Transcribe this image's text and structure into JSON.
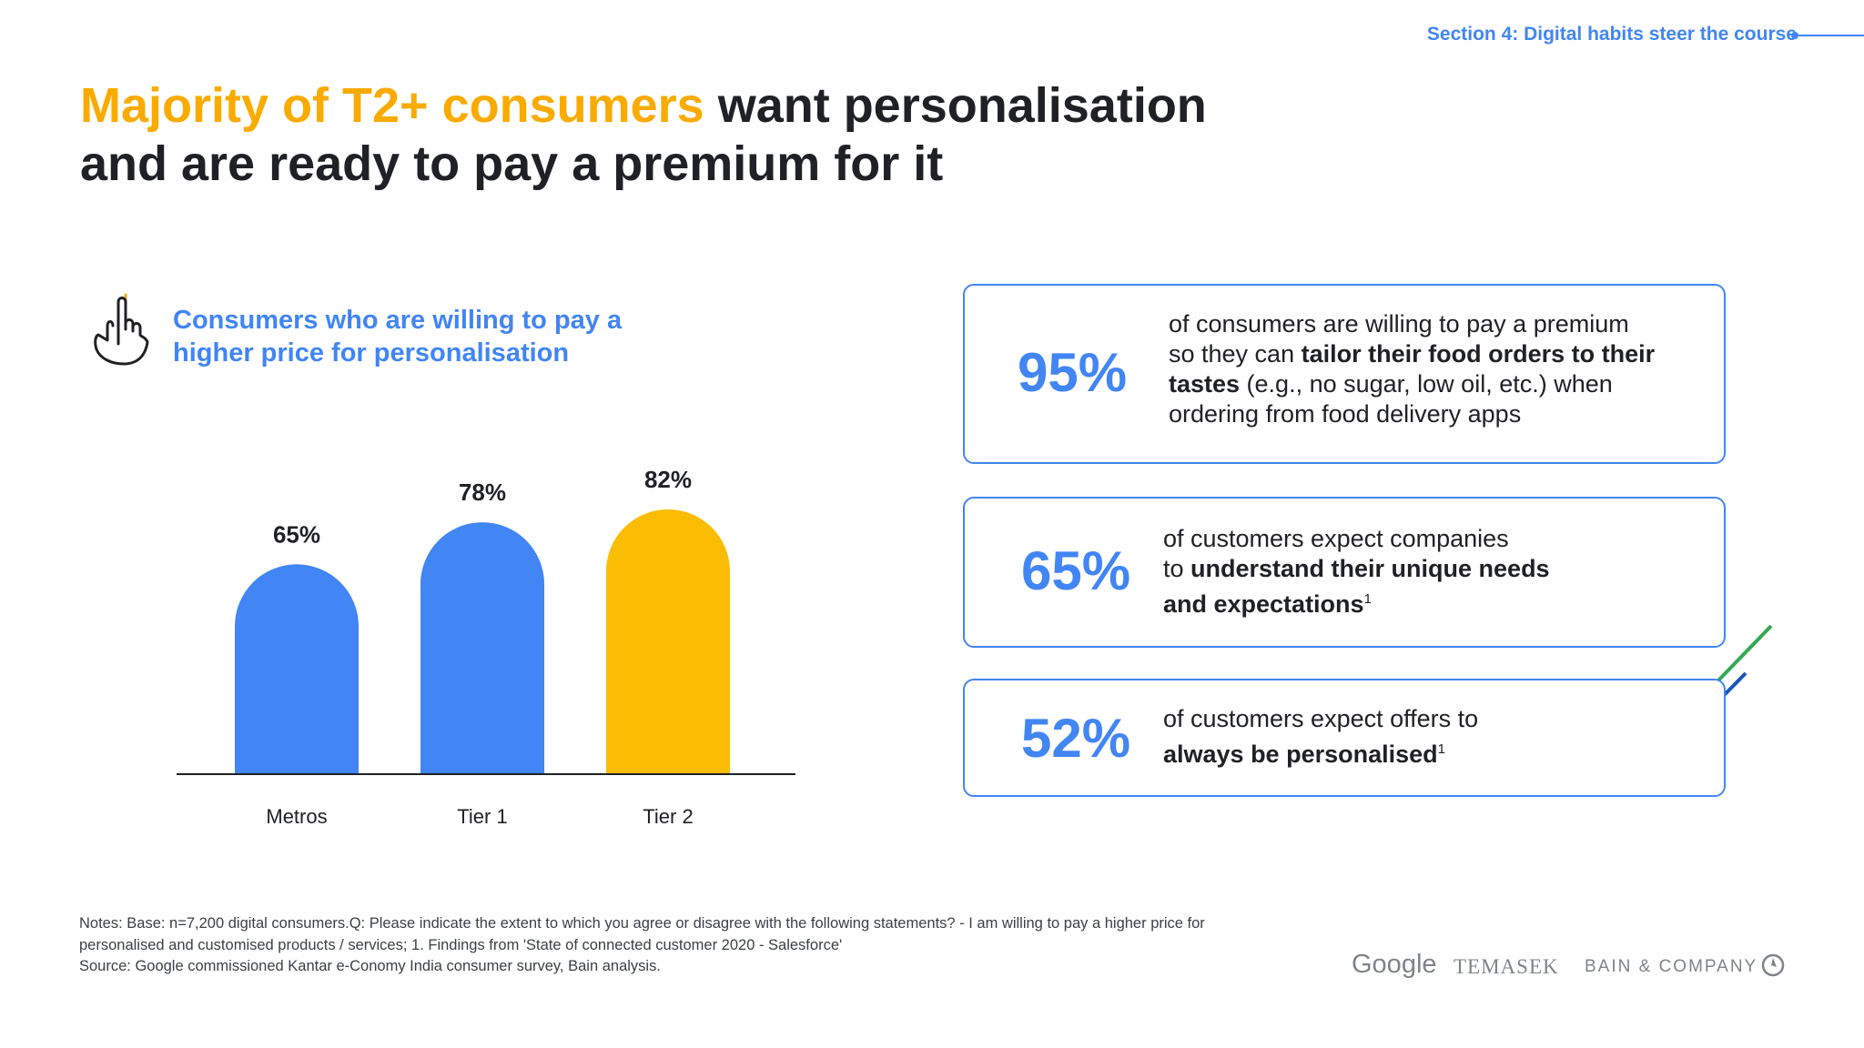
{
  "header": {
    "section": "Section 4: Digital habits steer the course"
  },
  "title": {
    "highlight": "Majority of T2+ consumers",
    "rest_line1": " want personalisation",
    "line2": "and are ready to pay a premium for it"
  },
  "chart_heading": {
    "icon": "hand-pointer-icon",
    "line1": "Consumers who are willing to pay a",
    "line2": "higher price for personalisation"
  },
  "chart_data": {
    "type": "bar",
    "categories": [
      "Metros",
      "Tier 1",
      "Tier 2"
    ],
    "values": [
      65,
      78,
      82
    ],
    "data_labels": [
      "65%",
      "78%",
      "82%"
    ],
    "colors": [
      "#4285F4",
      "#4285F4",
      "#FBBC04"
    ],
    "ylim": [
      0,
      100
    ],
    "grid": false
  },
  "stats": [
    {
      "value": "95%",
      "t1": "of consumers are willing to pay a premium",
      "t2": "so they can ",
      "b1": "tailor their food orders to their",
      "b2": "tastes",
      "t3": " (e.g., no sugar, low oil, etc.) when",
      "t4": "ordering from food delivery apps"
    },
    {
      "value": "65%",
      "t1": "of customers expect companies",
      "t2": "to ",
      "b1": "understand their unique needs",
      "b2": "and expectations",
      "sup": "1"
    },
    {
      "value": "52%",
      "t1": "of customers expect offers to",
      "b1": "always be personalised",
      "sup": "1"
    }
  ],
  "notes": {
    "line1": "Notes: Base: n=7,200 digital consumers.Q: Please indicate the extent to which you agree or disagree with the following statements? - I am willing to pay a higher price for",
    "line2": "personalised and customised products / services; 1. Findings from 'State of connected customer 2020 - Salesforce'",
    "line3": "Source: Google commissioned Kantar e-Conomy India consumer survey, Bain analysis."
  },
  "logos": {
    "google": "Google",
    "temasek": "TEMASEK",
    "bain": "BAIN & COMPANY"
  },
  "accent_colors": {
    "blue": "#4285F4",
    "yellow": "#FBBC04",
    "green": "#34A853",
    "dark_blue": "#1A56B8"
  }
}
